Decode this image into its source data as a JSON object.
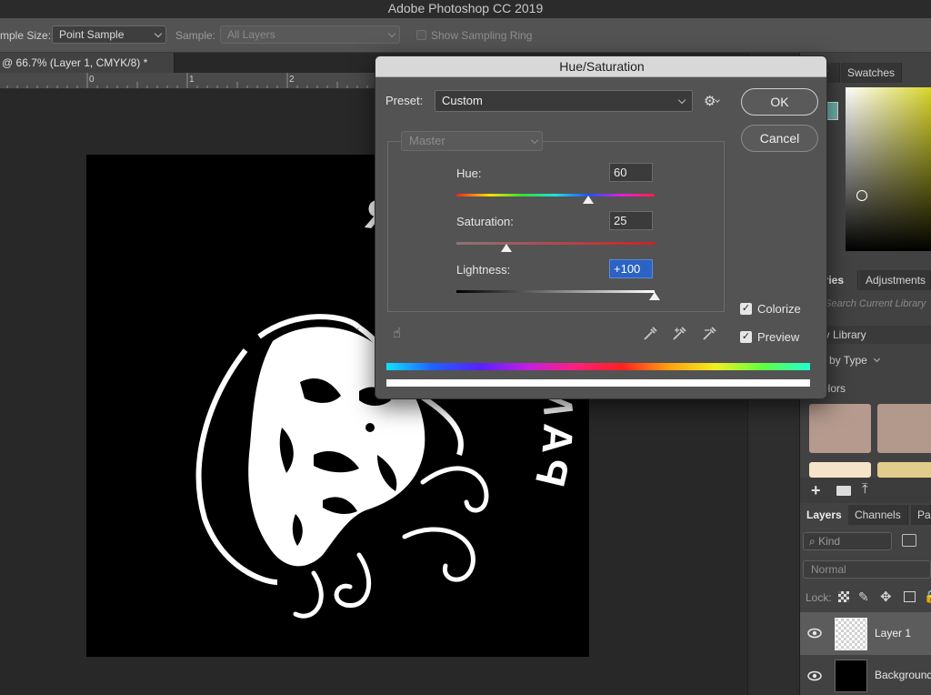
{
  "app": {
    "title": "Adobe Photoshop CC 2019"
  },
  "options_bar": {
    "sample_size_label": "mple Size:",
    "sample_size_value": "Point Sample",
    "sample_label": "Sample:",
    "sample_value": "All Layers",
    "show_sampling_ring": "Show Sampling Ring"
  },
  "document": {
    "tab_label": "@ 66.7% (Layer 1, CMYK/8) *",
    "ruler_marks": [
      "0",
      "1",
      "2"
    ],
    "artwork_text": "PANTHERA PRESS"
  },
  "dialog": {
    "title": "Hue/Saturation",
    "preset_label": "Preset:",
    "preset_value": "Custom",
    "ok_label": "OK",
    "cancel_label": "Cancel",
    "channel_value": "Master",
    "hue_label": "Hue:",
    "hue_value": "60",
    "saturation_label": "Saturation:",
    "saturation_value": "25",
    "lightness_label": "Lightness:",
    "lightness_value": "+100",
    "colorize_label": "Colorize",
    "colorize_checked": true,
    "preview_label": "Preview",
    "preview_checked": true,
    "hue_range": [
      -180,
      180
    ],
    "saturation_range": [
      0,
      100
    ],
    "lightness_range": [
      -100,
      100
    ]
  },
  "panels": {
    "color_tab_a": "or",
    "color_tab_b": "Swatches",
    "libraries_tab": "aries",
    "adjustments_tab": "Adjustments",
    "search_placeholder": "Search Current Library",
    "library_name": "ly Library",
    "view_by": "w by Type",
    "colors_heading": "olors",
    "swatch_colors": [
      "#b59a8d",
      "#b3988c",
      "#f5e4c8",
      "#e0cd8c"
    ],
    "accent_color": "#6fb7b0",
    "layers_tab": "Layers",
    "channels_tab": "Channels",
    "paths_tab": "Pa",
    "kind_label": "Kind",
    "blend_mode": "Normal",
    "lock_label": "Lock:",
    "layers": [
      {
        "name": "Layer 1"
      },
      {
        "name": "Background"
      }
    ]
  }
}
